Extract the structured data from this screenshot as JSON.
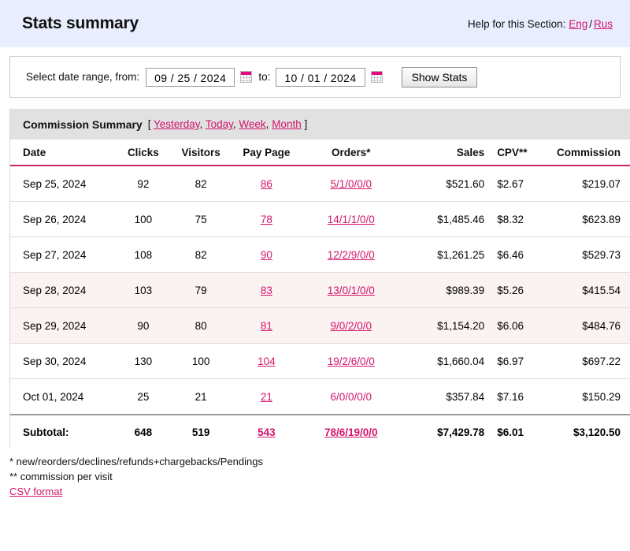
{
  "header": {
    "title": "Stats summary",
    "help_label": "Help for this Section:",
    "help_links": [
      "Eng",
      "Rus"
    ],
    "separator": "/"
  },
  "date_range": {
    "label": "Select date range, from:",
    "from_value": "09 / 25 / 2024",
    "to_label": "to:",
    "to_value": "10 / 01 / 2024",
    "submit_label": "Show Stats",
    "calendar_icon": "calendar-icon"
  },
  "summary": {
    "title": "Commission Summary",
    "bracket_open": "[",
    "bracket_close": "]",
    "quick_links": [
      "Yesterday",
      "Today",
      "Week",
      "Month"
    ],
    "comma": ","
  },
  "table": {
    "headers": [
      "Date",
      "Clicks",
      "Visitors",
      "Pay Page",
      "Orders*",
      "Sales",
      "CPV**",
      "Commission"
    ],
    "rows": [
      {
        "date": "Sep 25, 2024",
        "clicks": "92",
        "visitors": "82",
        "pay_page": "86",
        "orders": "5/1/0/0/0",
        "sales": "$521.60",
        "cpv": "$2.67",
        "commission": "$219.07",
        "alt": false,
        "orders_link": true
      },
      {
        "date": "Sep 26, 2024",
        "clicks": "100",
        "visitors": "75",
        "pay_page": "78",
        "orders": "14/1/1/0/0",
        "sales": "$1,485.46",
        "cpv": "$8.32",
        "commission": "$623.89",
        "alt": false,
        "orders_link": true
      },
      {
        "date": "Sep 27, 2024",
        "clicks": "108",
        "visitors": "82",
        "pay_page": "90",
        "orders": "12/2/9/0/0",
        "sales": "$1,261.25",
        "cpv": "$6.46",
        "commission": "$529.73",
        "alt": false,
        "orders_link": true
      },
      {
        "date": "Sep 28, 2024",
        "clicks": "103",
        "visitors": "79",
        "pay_page": "83",
        "orders": "13/0/1/0/0",
        "sales": "$989.39",
        "cpv": "$5.26",
        "commission": "$415.54",
        "alt": true,
        "orders_link": true
      },
      {
        "date": "Sep 29, 2024",
        "clicks": "90",
        "visitors": "80",
        "pay_page": "81",
        "orders": "9/0/2/0/0",
        "sales": "$1,154.20",
        "cpv": "$6.06",
        "commission": "$484.76",
        "alt": true,
        "orders_link": true
      },
      {
        "date": "Sep 30, 2024",
        "clicks": "130",
        "visitors": "100",
        "pay_page": "104",
        "orders": "19/2/6/0/0",
        "sales": "$1,660.04",
        "cpv": "$6.97",
        "commission": "$697.22",
        "alt": false,
        "orders_link": true
      },
      {
        "date": "Oct 01, 2024",
        "clicks": "25",
        "visitors": "21",
        "pay_page": "21",
        "orders": "6/0/0/0/0",
        "sales": "$357.84",
        "cpv": "$7.16",
        "commission": "$150.29",
        "alt": false,
        "orders_link": false
      }
    ],
    "subtotal": {
      "date": "Subtotal:",
      "clicks": "648",
      "visitors": "519",
      "pay_page": "543",
      "orders": "78/6/19/0/0",
      "sales": "$7,429.78",
      "cpv": "$6.01",
      "commission": "$3,120.50"
    }
  },
  "footnotes": {
    "line1": "* new/reorders/declines/refunds+chargebacks/Pendings",
    "line2": "** commission per visit",
    "csv_link": "CSV format"
  },
  "colors": {
    "header_band": "#e9eeff",
    "link": "#d4146b",
    "accent_rule": "#c4286b",
    "alt_row": "#fbf2f2",
    "title_bar": "#e1e1e1"
  }
}
